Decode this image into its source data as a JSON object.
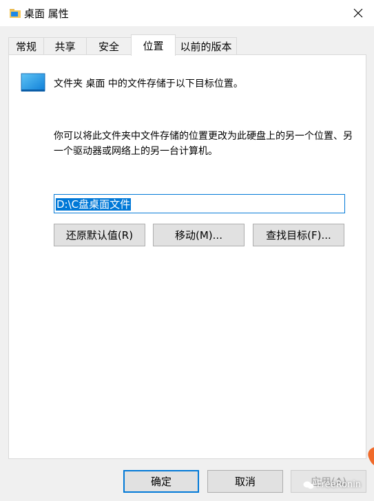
{
  "window": {
    "title": "桌面 属性"
  },
  "tabs": [
    {
      "label": "常规"
    },
    {
      "label": "共享"
    },
    {
      "label": "安全"
    },
    {
      "label": "位置"
    },
    {
      "label": "以前的版本"
    }
  ],
  "active_tab": "位置",
  "panel": {
    "description_primary": "文件夹 桌面 中的文件存储于以下目标位置。",
    "description_secondary": "你可以将此文件夹中文件存储的位置更改为此硬盘上的另一个位置、另一个驱动器或网络上的另一台计算机。",
    "path_value": "D:\\C盘桌面文件",
    "buttons": {
      "restore": "还原默认值(R)",
      "move": "移动(M)...",
      "find_target": "查找目标(F)..."
    }
  },
  "footer": {
    "ok": "确定",
    "cancel": "取消",
    "apply": "应用(A)"
  },
  "watermark": {
    "text": "FreeRonin"
  },
  "icons": {
    "title": "folder-icon",
    "close": "close-icon",
    "location": "desktop-folder-icon"
  },
  "colors": {
    "accent": "#0078d7",
    "button_face": "#e1e1e1",
    "disabled_text": "#a0a0a0"
  }
}
